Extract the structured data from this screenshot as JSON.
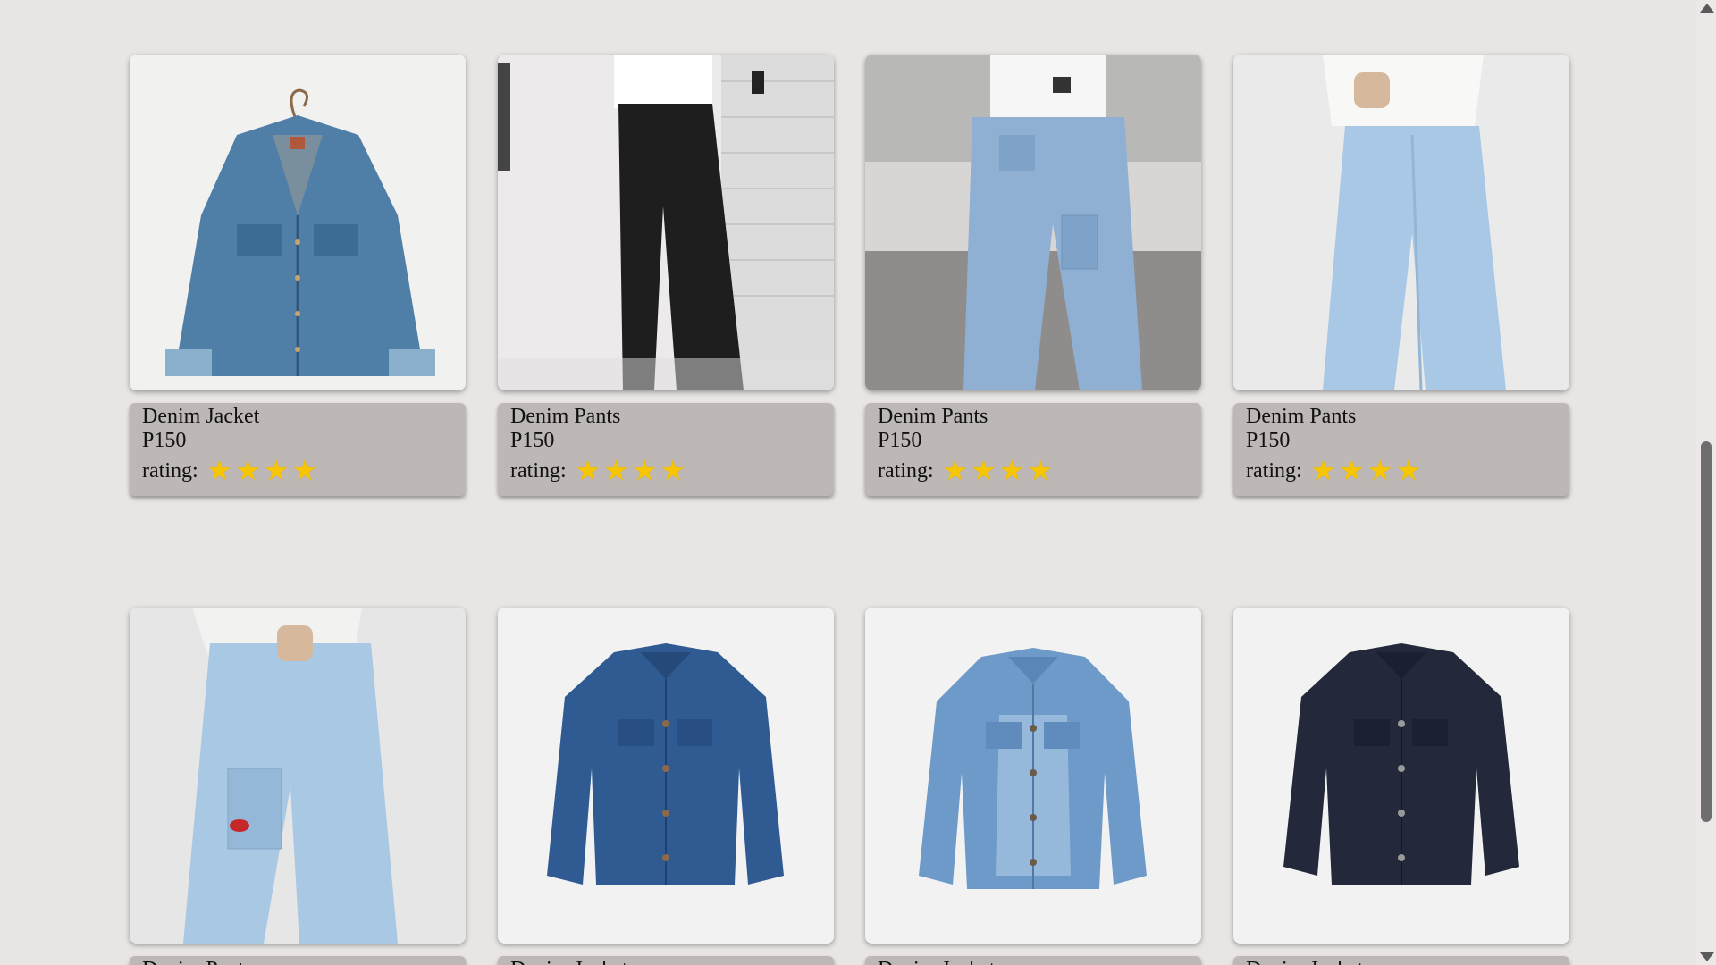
{
  "products_row1": [
    {
      "name": "Denim Jacket",
      "price": "P150",
      "rating_label": "rating:",
      "stars": 4,
      "image": "denim-jacket-on-hanger"
    },
    {
      "name": "Denim Pants",
      "price": "P150",
      "rating_label": "rating:",
      "stars": 4,
      "image": "black-denim-pants"
    },
    {
      "name": "Denim Pants",
      "price": "P150",
      "rating_label": "rating:",
      "stars": 4,
      "image": "blue-cargo-denim-pants"
    },
    {
      "name": "Denim Pants",
      "price": "P150",
      "rating_label": "rating:",
      "stars": 4,
      "image": "light-blue-denim-pants"
    }
  ],
  "products_row2": [
    {
      "name": "Denim Pants",
      "image": "light-blue-cargo-pants"
    },
    {
      "name": "Denim Jacket",
      "image": "dark-blue-denim-jacket"
    },
    {
      "name": "Denim Jacket",
      "image": "light-wash-denim-jacket"
    },
    {
      "name": "Denim Jacket",
      "image": "navy-denim-jacket"
    }
  ],
  "star_glyph": "★",
  "colors": {
    "background": "#e8e5e4",
    "info_panel": "#bdb8b6",
    "star": "#f7c600"
  }
}
